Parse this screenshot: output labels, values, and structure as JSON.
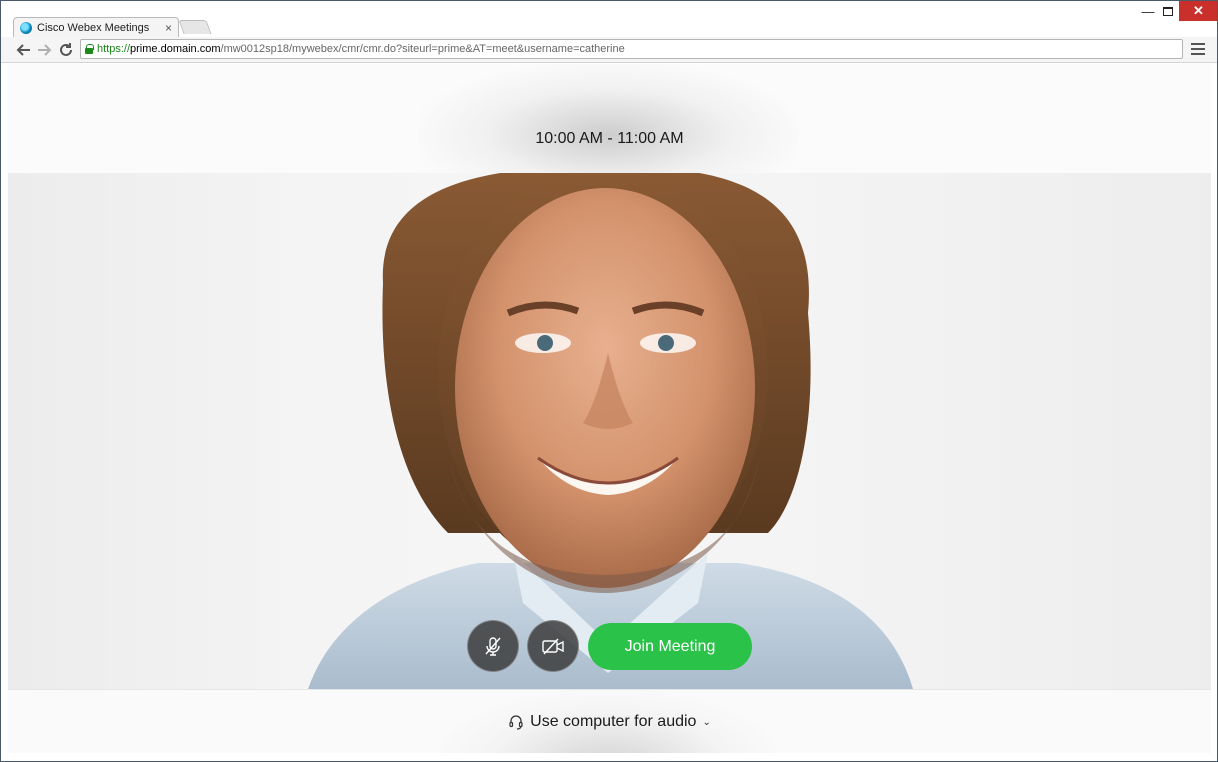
{
  "browser": {
    "tab_title": "Cisco Webex Meetings",
    "tab_close": "×",
    "url_scheme": "https://",
    "url_host": "prime.domain.com",
    "url_path": "/mw0012sp18/mywebex/cmr/cmr.do?siteurl=prime&AT=meet&username=catherine",
    "window_min": "—",
    "window_close": "✕"
  },
  "meeting": {
    "time_range": "10:00 AM - 11:00 AM",
    "join_label": "Join Meeting",
    "audio_option": "Use computer for audio"
  },
  "colors": {
    "join_green": "#2bc24a",
    "secure_green": "#1a8a1a",
    "close_red": "#c9302c"
  },
  "icons": {
    "mute": "microphone-muted-icon",
    "video": "video-off-icon",
    "audio": "headset-icon"
  }
}
